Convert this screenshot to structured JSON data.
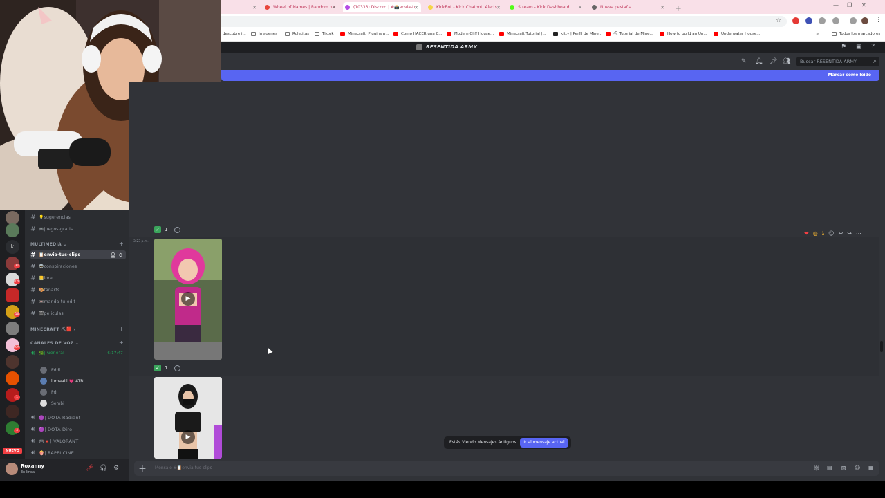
{
  "browser": {
    "tabs": [
      {
        "label": "Wheel of Names | Random na...",
        "color": "#e8453c"
      },
      {
        "label": "(10333) Discord | #📸envia-tu...",
        "color": "#b64be5"
      },
      {
        "label": "KickBot - Kick Chatbot, Alerts",
        "color": "#f5d547"
      },
      {
        "label": "Stream - Kick Dashboard",
        "color": "#53fc18"
      },
      {
        "label": "Nueva pestaña",
        "color": "#666666"
      }
    ],
    "bookmarks": [
      {
        "label": "descubre i...",
        "color": "#555555"
      },
      {
        "label": "Imagenes",
        "color": "#777777"
      },
      {
        "label": "Ruletitas",
        "color": "#777777"
      },
      {
        "label": "Tiktok",
        "color": "#777777"
      },
      {
        "label": "Minecraft: Plugins p...",
        "color": "#ff0000"
      },
      {
        "label": "Como HACER una C...",
        "color": "#ff0000"
      },
      {
        "label": "Modern Cliff House...",
        "color": "#ff0000"
      },
      {
        "label": "Minecraft Tutorial |...",
        "color": "#ff0000"
      },
      {
        "label": "kitty | Perfil de Mine...",
        "color": "#222222"
      },
      {
        "label": "⛏ Tutorial de Mine...",
        "color": "#ff0000"
      },
      {
        "label": "How to build an Un...",
        "color": "#ff0000"
      },
      {
        "label": "Underwater House...",
        "color": "#ff0000"
      },
      {
        "label": "Todos los marcadores",
        "color": "#777777"
      }
    ]
  },
  "server": {
    "name": "RESENTIDA ARMY"
  },
  "header": {
    "search_placeholder": "Buscar RESENTIDA ARMY",
    "new_messages_label": "Marcar como leído"
  },
  "sidebar": {
    "channels_top": [
      {
        "name": "💡sugerencias"
      },
      {
        "name": "🎮juegos-gratis"
      }
    ],
    "category_multimedia": "MULTIMEDIA",
    "multimedia_channels": [
      {
        "name": "📋envia-tus-clips",
        "selected": true
      },
      {
        "name": "👽conspiraciones"
      },
      {
        "name": "📒lore"
      },
      {
        "name": "🎨fanarts"
      },
      {
        "name": "📼manda-tu-edit"
      },
      {
        "name": "🎬peliculas"
      }
    ],
    "category_minecraft": "MINECRAFT ⛏🟥",
    "category_voice": "CANALES DE VOZ",
    "voice_general": {
      "name": "🌿| General",
      "time": "6:17:47"
    },
    "voice_users": [
      {
        "name": "Eddl"
      },
      {
        "name": "lumaaiil 💗 ATBL"
      },
      {
        "name": "Pdr"
      },
      {
        "name": "Sembi"
      }
    ],
    "voice_channels": [
      {
        "name": "🟣| DOTA Radiant"
      },
      {
        "name": "🟣| DOTA Dire"
      },
      {
        "name": "🎮🔺| VALORANT"
      },
      {
        "name": "🍿| RAPPI CINE"
      }
    ],
    "new_badge": "NUEVO"
  },
  "guild_badges": [
    "1",
    "31",
    "428",
    "16",
    "229",
    "1",
    "4"
  ],
  "user": {
    "name": "Roxanny",
    "status": "En línea"
  },
  "chat": {
    "reaction_count_1": "1",
    "reaction_count_2": "1",
    "reaction_count_3": "1",
    "timestamp": "3:23 p.m.",
    "old_messages_label": "Estás Viendo Mensajes Antiguos",
    "jump_button": "Ir al mensaje actual",
    "composer_placeholder": "Mensaje #📋envia-tus-clips"
  }
}
